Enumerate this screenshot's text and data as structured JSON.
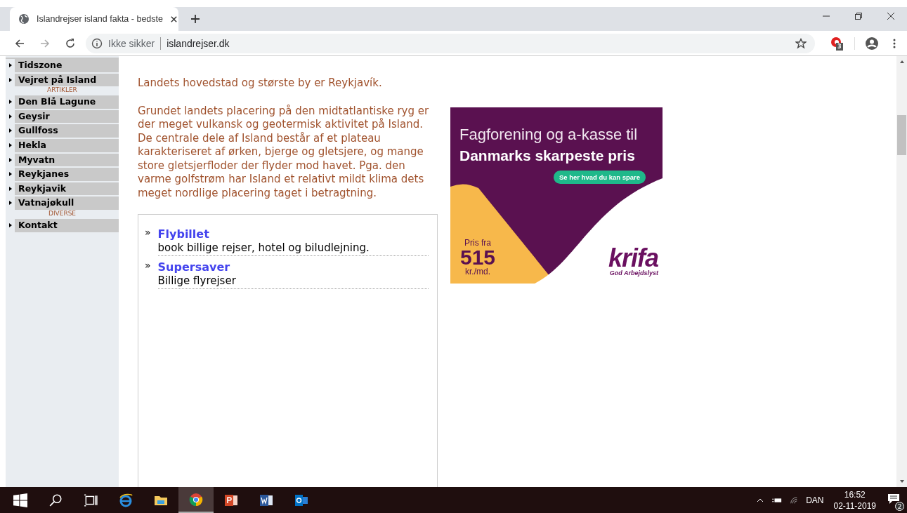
{
  "browser": {
    "tab": {
      "title": "Islandrejser island fakta - bedste"
    },
    "address": {
      "security_label": "Ikke sikker",
      "url": "islandrejser.dk"
    },
    "extension_badge": "3"
  },
  "sidebar": {
    "items": [
      {
        "kind": "link",
        "label": "Tidszone"
      },
      {
        "kind": "link",
        "label": "Vejret på Island"
      },
      {
        "kind": "heading",
        "label": "ARTIKLER"
      },
      {
        "kind": "link",
        "label": "Den Blå Lagune"
      },
      {
        "kind": "link",
        "label": "Geysir"
      },
      {
        "kind": "link",
        "label": "Gullfoss"
      },
      {
        "kind": "link",
        "label": "Hekla"
      },
      {
        "kind": "link",
        "label": "Myvatn"
      },
      {
        "kind": "link",
        "label": "Reykjanes"
      },
      {
        "kind": "link",
        "label": "Reykjavik"
      },
      {
        "kind": "link",
        "label": "Vatnajøkull"
      },
      {
        "kind": "heading",
        "label": "DIVERSE"
      },
      {
        "kind": "link",
        "label": "Kontakt"
      }
    ]
  },
  "content": {
    "paragraphs": [
      "Landets hovedstad og største by er Reykjavík.",
      "Grundet landets placering på den midtatlantiske ryg er der meget vulkansk og geotermisk aktivitet på Island. De centrale dele af Island består af et plateau karakteriseret af ørken, bjerge og gletsjere, og mange store gletsjerfloder der flyder mod havet. Pga. den varme golfstrøm har Island et relativt mildt klima dets meget nordlige placering taget i betragtning."
    ],
    "links": [
      {
        "bullet": "»",
        "title": "Flybillet",
        "description": "book billige rejser, hotel og biludlejning."
      },
      {
        "bullet": "»",
        "title": "Supersaver",
        "description": "Billige flyrejser"
      }
    ]
  },
  "ad": {
    "headline": "Fagforening og a-kasse til",
    "headline_bold": "Danmarks skarpeste pris",
    "button": "Se her hvad du kan spare",
    "price_label": "Pris fra",
    "price": "515",
    "price_unit": "kr./md.",
    "brand": "krifa",
    "tagline": "God Arbejdslyst"
  },
  "taskbar": {
    "language": "DAN",
    "time": "16:52",
    "date": "02-11-2019",
    "notification_count": "2"
  }
}
